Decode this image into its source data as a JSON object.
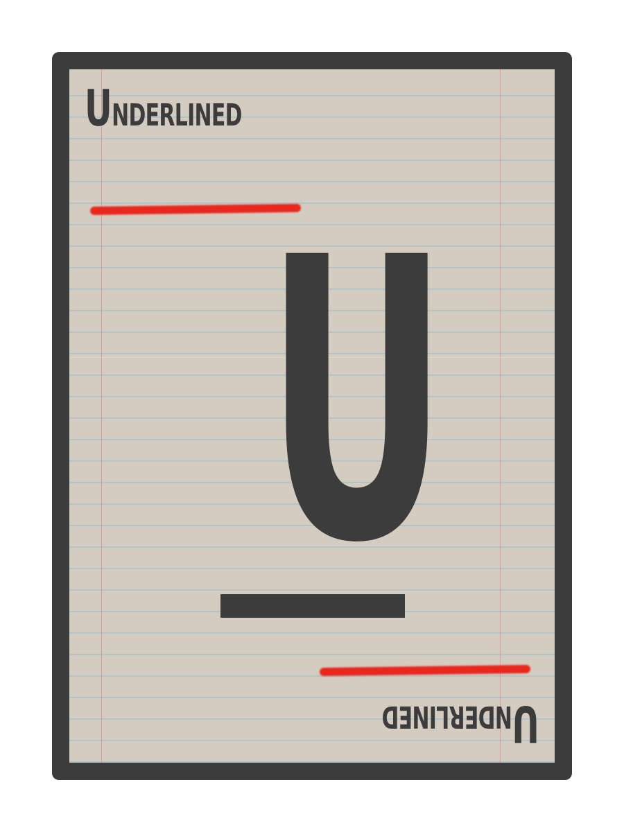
{
  "card": {
    "top_word_first": "U",
    "top_word_rest": "NDERLINED",
    "center_letter": "U",
    "bottom_word_first": "U",
    "bottom_word_rest": "NDERLINED"
  },
  "colors": {
    "frame": "#3c3c3c",
    "paper": "#d4ccc0",
    "underline_accent": "#e8281f",
    "ink": "#3c3c3c"
  }
}
